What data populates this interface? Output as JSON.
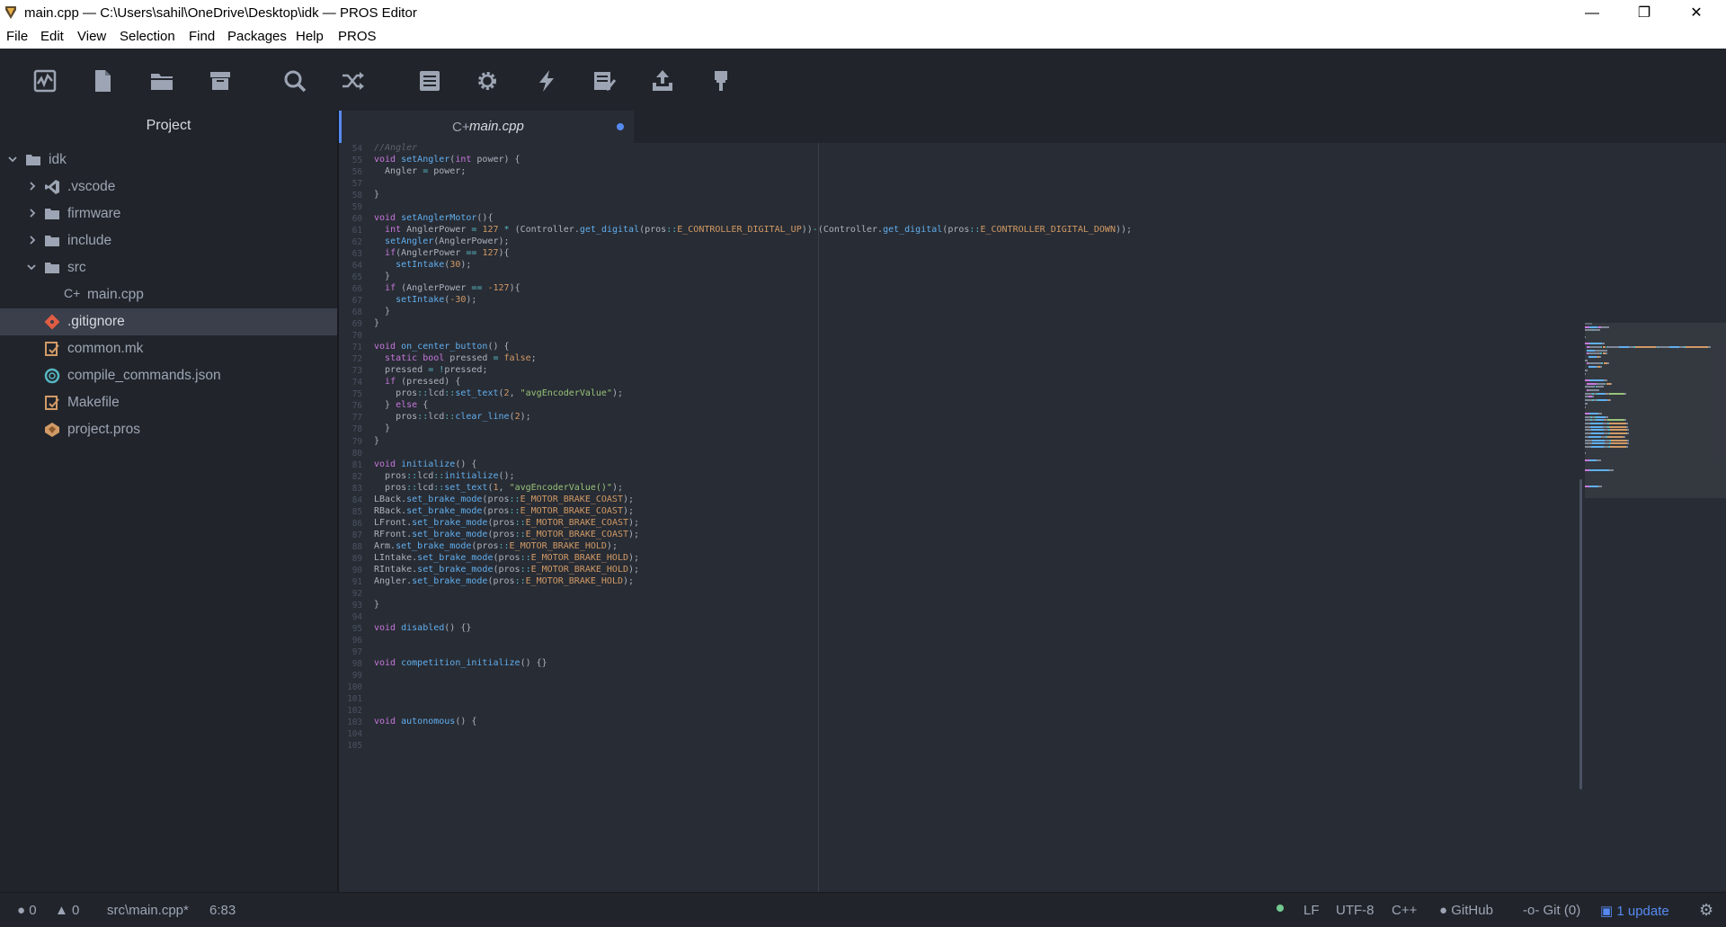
{
  "window": {
    "title": "main.cpp — C:\\Users\\sahil\\OneDrive\\Desktop\\idk — PROS Editor",
    "minimize": "—",
    "maximize": "❐",
    "close": "✕"
  },
  "menu": [
    "File",
    "Edit",
    "View",
    "Selection",
    "Find",
    "Packages",
    "Help",
    "PROS"
  ],
  "toolbar": [
    "pulse-icon",
    "new-file-icon",
    "folder-icon",
    "archive-icon",
    "search-icon",
    "shuffle-icon",
    "list-icon",
    "gear-icon",
    "lightning-icon",
    "checklist-icon",
    "upload-icon",
    "brush-icon"
  ],
  "sidebar": {
    "title": "Project",
    "items": [
      {
        "label": "idk",
        "type": "folder-open"
      },
      {
        "label": ".vscode",
        "type": "vscode"
      },
      {
        "label": "firmware",
        "type": "folder"
      },
      {
        "label": "include",
        "type": "folder"
      },
      {
        "label": "src",
        "type": "folder-open"
      },
      {
        "label": "main.cpp",
        "type": "cpp"
      },
      {
        "label": ".gitignore",
        "type": "git"
      },
      {
        "label": "common.mk",
        "type": "make"
      },
      {
        "label": "compile_commands.json",
        "type": "json"
      },
      {
        "label": "Makefile",
        "type": "make"
      },
      {
        "label": "project.pros",
        "type": "pros"
      }
    ]
  },
  "tab": {
    "icon": "C+",
    "label": "main.cpp"
  },
  "line_numbers": [
    "54",
    "55",
    "56",
    "57",
    "58",
    "59",
    "60",
    "61",
    "62",
    "63",
    "64",
    "65",
    "66",
    "67",
    "68",
    "69",
    "70",
    "71",
    "72",
    "73",
    "74",
    "75",
    "76",
    "77",
    "78",
    "79",
    "80",
    "81",
    "82",
    "83",
    "84",
    "85",
    "86",
    "87",
    "88",
    "89",
    "90",
    "91",
    "92",
    "93",
    "94",
    "95",
    "96",
    "97",
    "98",
    "99",
    "100",
    "101",
    "102",
    "103",
    "104",
    "105"
  ],
  "code": [
    [
      [
        "//Angler",
        "cm"
      ]
    ],
    [
      [
        "void ",
        "kw"
      ],
      [
        "setAngler",
        "fn"
      ],
      [
        "(",
        ""
      ],
      [
        "int",
        "kw"
      ],
      [
        " power) {",
        ""
      ]
    ],
    [
      [
        "  Angler ",
        ""
      ],
      [
        "=",
        "op"
      ],
      [
        " power;",
        ""
      ]
    ],
    [
      [
        "",
        ""
      ]
    ],
    [
      [
        "}",
        ""
      ]
    ],
    [
      [
        "",
        ""
      ]
    ],
    [
      [
        "void ",
        "kw"
      ],
      [
        "setAnglerMotor",
        "fn"
      ],
      [
        "(){",
        ""
      ]
    ],
    [
      [
        "  ",
        ""
      ],
      [
        "int",
        "kw"
      ],
      [
        " AnglerPower ",
        ""
      ],
      [
        "=",
        "op"
      ],
      [
        " ",
        ""
      ],
      [
        "127",
        "nm"
      ],
      [
        " ",
        ""
      ],
      [
        "*",
        "op"
      ],
      [
        " (Controller.",
        ""
      ],
      [
        "get_digital",
        "fn"
      ],
      [
        "(pros",
        ""
      ],
      [
        "::",
        "op"
      ],
      [
        "E_CONTROLLER_DIGITAL_UP",
        "en"
      ],
      [
        "))",
        ""
      ],
      [
        "-",
        "op"
      ],
      [
        "(Controller.",
        ""
      ],
      [
        "get_digital",
        "fn"
      ],
      [
        "(pros",
        ""
      ],
      [
        "::",
        "op"
      ],
      [
        "E_CONTROLLER_DIGITAL_DOWN",
        "en"
      ],
      [
        "));",
        ""
      ]
    ],
    [
      [
        "  ",
        ""
      ],
      [
        "setAngler",
        "fn"
      ],
      [
        "(AnglerPower);",
        ""
      ]
    ],
    [
      [
        "  ",
        ""
      ],
      [
        "if",
        "kw"
      ],
      [
        "(AnglerPower ",
        ""
      ],
      [
        "==",
        "op"
      ],
      [
        " ",
        ""
      ],
      [
        "127",
        "nm"
      ],
      [
        "){",
        ""
      ]
    ],
    [
      [
        "    ",
        ""
      ],
      [
        "setIntake",
        "fn"
      ],
      [
        "(",
        ""
      ],
      [
        "30",
        "nm"
      ],
      [
        ");",
        ""
      ]
    ],
    [
      [
        "  }",
        ""
      ]
    ],
    [
      [
        "  ",
        ""
      ],
      [
        "if",
        "kw"
      ],
      [
        " (AnglerPower ",
        ""
      ],
      [
        "==",
        "op"
      ],
      [
        " ",
        ""
      ],
      [
        "-127",
        "nm"
      ],
      [
        "){",
        ""
      ]
    ],
    [
      [
        "    ",
        ""
      ],
      [
        "setIntake",
        "fn"
      ],
      [
        "(",
        ""
      ],
      [
        "-30",
        "nm"
      ],
      [
        ");",
        ""
      ]
    ],
    [
      [
        "  }",
        ""
      ]
    ],
    [
      [
        "}",
        ""
      ]
    ],
    [
      [
        "",
        ""
      ]
    ],
    [
      [
        "void ",
        "kw"
      ],
      [
        "on_center_button",
        "fn"
      ],
      [
        "() {",
        ""
      ]
    ],
    [
      [
        "  ",
        ""
      ],
      [
        "static bool",
        "kw"
      ],
      [
        " pressed ",
        ""
      ],
      [
        "=",
        "op"
      ],
      [
        " ",
        ""
      ],
      [
        "false",
        "nm"
      ],
      [
        ";",
        ""
      ]
    ],
    [
      [
        "  pressed ",
        ""
      ],
      [
        "=",
        "op"
      ],
      [
        " ",
        ""
      ],
      [
        "!",
        "op"
      ],
      [
        "pressed;",
        ""
      ]
    ],
    [
      [
        "  ",
        ""
      ],
      [
        "if",
        "kw"
      ],
      [
        " (pressed) {",
        ""
      ]
    ],
    [
      [
        "    pros",
        ""
      ],
      [
        "::",
        "op"
      ],
      [
        "lcd",
        ""
      ],
      [
        "::",
        "op"
      ],
      [
        "set_text",
        "fn"
      ],
      [
        "(",
        ""
      ],
      [
        "2",
        "nm"
      ],
      [
        ", ",
        ""
      ],
      [
        "\"avgEncoderValue\"",
        "st-str"
      ],
      [
        ");",
        ""
      ]
    ],
    [
      [
        "  } ",
        ""
      ],
      [
        "else",
        "kw"
      ],
      [
        " {",
        ""
      ]
    ],
    [
      [
        "    pros",
        ""
      ],
      [
        "::",
        "op"
      ],
      [
        "lcd",
        ""
      ],
      [
        "::",
        "op"
      ],
      [
        "clear_line",
        "fn"
      ],
      [
        "(",
        ""
      ],
      [
        "2",
        "nm"
      ],
      [
        ");",
        ""
      ]
    ],
    [
      [
        "  }",
        ""
      ]
    ],
    [
      [
        "}",
        ""
      ]
    ],
    [
      [
        "",
        ""
      ]
    ],
    [
      [
        "void ",
        "kw"
      ],
      [
        "initialize",
        "fn"
      ],
      [
        "() {",
        ""
      ]
    ],
    [
      [
        "  pros",
        ""
      ],
      [
        "::",
        "op"
      ],
      [
        "lcd",
        ""
      ],
      [
        "::",
        "op"
      ],
      [
        "initialize",
        "fn"
      ],
      [
        "();",
        ""
      ]
    ],
    [
      [
        "  pros",
        ""
      ],
      [
        "::",
        "op"
      ],
      [
        "lcd",
        ""
      ],
      [
        "::",
        "op"
      ],
      [
        "set_text",
        "fn"
      ],
      [
        "(",
        ""
      ],
      [
        "1",
        "nm"
      ],
      [
        ", ",
        ""
      ],
      [
        "\"avgEncoderValue()\"",
        "st-str"
      ],
      [
        ");",
        ""
      ]
    ],
    [
      [
        "LBack.",
        ""
      ],
      [
        "set_brake_mode",
        "fn"
      ],
      [
        "(pros",
        ""
      ],
      [
        "::",
        "op"
      ],
      [
        "E_MOTOR_BRAKE_COAST",
        "en"
      ],
      [
        ");",
        ""
      ]
    ],
    [
      [
        "RBack.",
        ""
      ],
      [
        "set_brake_mode",
        "fn"
      ],
      [
        "(pros",
        ""
      ],
      [
        "::",
        "op"
      ],
      [
        "E_MOTOR_BRAKE_COAST",
        "en"
      ],
      [
        ");",
        ""
      ]
    ],
    [
      [
        "LFront.",
        ""
      ],
      [
        "set_brake_mode",
        "fn"
      ],
      [
        "(pros",
        ""
      ],
      [
        "::",
        "op"
      ],
      [
        "E_MOTOR_BRAKE_COAST",
        "en"
      ],
      [
        ");",
        ""
      ]
    ],
    [
      [
        "RFront.",
        ""
      ],
      [
        "set_brake_mode",
        "fn"
      ],
      [
        "(pros",
        ""
      ],
      [
        "::",
        "op"
      ],
      [
        "E_MOTOR_BRAKE_COAST",
        "en"
      ],
      [
        ");",
        ""
      ]
    ],
    [
      [
        "Arm.",
        ""
      ],
      [
        "set_brake_mode",
        "fn"
      ],
      [
        "(pros",
        ""
      ],
      [
        "::",
        "op"
      ],
      [
        "E_MOTOR_BRAKE_HOLD",
        "en"
      ],
      [
        ");",
        ""
      ]
    ],
    [
      [
        "LIntake.",
        ""
      ],
      [
        "set_brake_mode",
        "fn"
      ],
      [
        "(pros",
        ""
      ],
      [
        "::",
        "op"
      ],
      [
        "E_MOTOR_BRAKE_HOLD",
        "en"
      ],
      [
        ");",
        ""
      ]
    ],
    [
      [
        "RIntake.",
        ""
      ],
      [
        "set_brake_mode",
        "fn"
      ],
      [
        "(pros",
        ""
      ],
      [
        "::",
        "op"
      ],
      [
        "E_MOTOR_BRAKE_HOLD",
        "en"
      ],
      [
        ");",
        ""
      ]
    ],
    [
      [
        "Angler.",
        ""
      ],
      [
        "set_brake_mode",
        "fn"
      ],
      [
        "(pros",
        ""
      ],
      [
        "::",
        "op"
      ],
      [
        "E_MOTOR_BRAKE_HOLD",
        "en"
      ],
      [
        ");",
        ""
      ]
    ],
    [
      [
        "",
        ""
      ]
    ],
    [
      [
        "}",
        ""
      ]
    ],
    [
      [
        "",
        ""
      ]
    ],
    [
      [
        "void ",
        "kw"
      ],
      [
        "disabled",
        "fn"
      ],
      [
        "() {}",
        ""
      ]
    ],
    [
      [
        "",
        ""
      ]
    ],
    [
      [
        "",
        ""
      ]
    ],
    [
      [
        "void ",
        "kw"
      ],
      [
        "competition_initialize",
        "fn"
      ],
      [
        "() {}",
        ""
      ]
    ],
    [
      [
        "",
        ""
      ]
    ],
    [
      [
        "",
        ""
      ]
    ],
    [
      [
        "",
        ""
      ]
    ],
    [
      [
        "",
        ""
      ]
    ],
    [
      [
        "void ",
        "kw"
      ],
      [
        "autonomous",
        "fn"
      ],
      [
        "() {",
        ""
      ]
    ],
    [
      [
        "",
        ""
      ]
    ],
    [
      [
        "",
        ""
      ]
    ]
  ],
  "status": {
    "errors": "0",
    "warnings": "0",
    "file": "src\\main.cpp*",
    "cursor": "6:83",
    "line_ending": "LF",
    "encoding": "UTF-8",
    "grammar": "C++",
    "github": "GitHub",
    "git": "Git (0)",
    "updates": "1 update"
  },
  "colors": {
    "accent": "#568af2",
    "background": "#282c34",
    "panel": "#21252b"
  }
}
